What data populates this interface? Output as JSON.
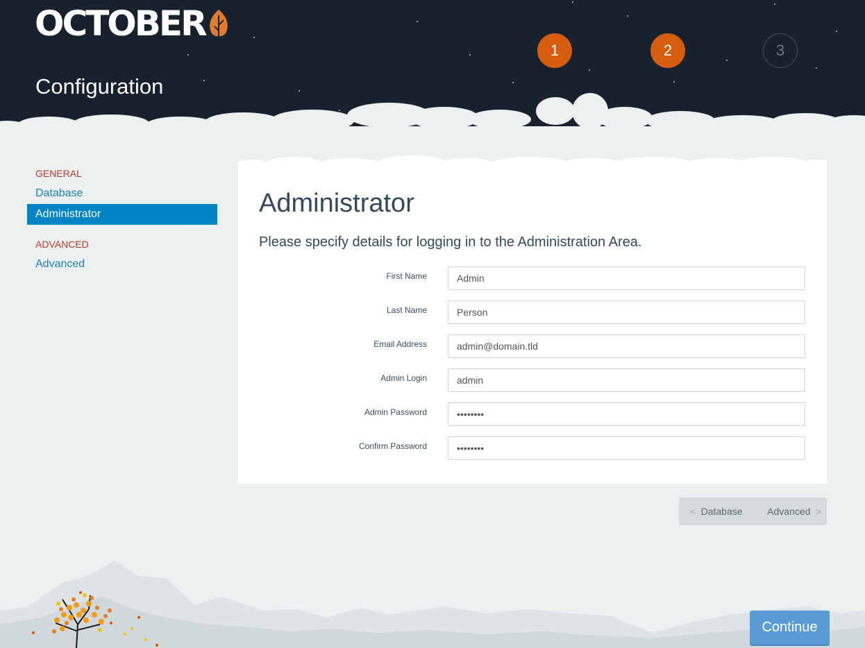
{
  "app": {
    "logo_text": "OCTOBER",
    "page_title": "Configuration"
  },
  "steps": [
    {
      "label": "1",
      "state": "done"
    },
    {
      "label": "2",
      "state": "current"
    },
    {
      "label": "3",
      "state": "pending"
    }
  ],
  "sidebar": {
    "sections": [
      {
        "title": "GENERAL",
        "items": [
          {
            "label": "Database",
            "active": false
          },
          {
            "label": "Administrator",
            "active": true
          }
        ]
      },
      {
        "title": "ADVANCED",
        "items": [
          {
            "label": "Advanced",
            "active": false
          }
        ]
      }
    ]
  },
  "main": {
    "title": "Administrator",
    "description": "Please specify details for logging in to the Administration Area.",
    "fields": [
      {
        "label": "First Name",
        "value": "Admin",
        "type": "text"
      },
      {
        "label": "Last Name",
        "value": "Person",
        "type": "text"
      },
      {
        "label": "Email Address",
        "value": "admin@domain.tld",
        "type": "text"
      },
      {
        "label": "Admin Login",
        "value": "admin",
        "type": "text"
      },
      {
        "label": "Admin Password",
        "value": "••••••••",
        "type": "password"
      },
      {
        "label": "Confirm Password",
        "value": "••••••••",
        "type": "password"
      }
    ]
  },
  "pager": {
    "prev_label": "Database",
    "next_label": "Advanced",
    "prev_icon": "<",
    "next_icon": ">"
  },
  "footer": {
    "continue_label": "Continue"
  },
  "colors": {
    "header_bg": "#18222f",
    "accent_orange": "#d65d0f",
    "link_blue": "#1d7fb8",
    "active_blue": "#0184c3",
    "section_red": "#c0392b",
    "continue_blue": "#5b9bd5"
  }
}
